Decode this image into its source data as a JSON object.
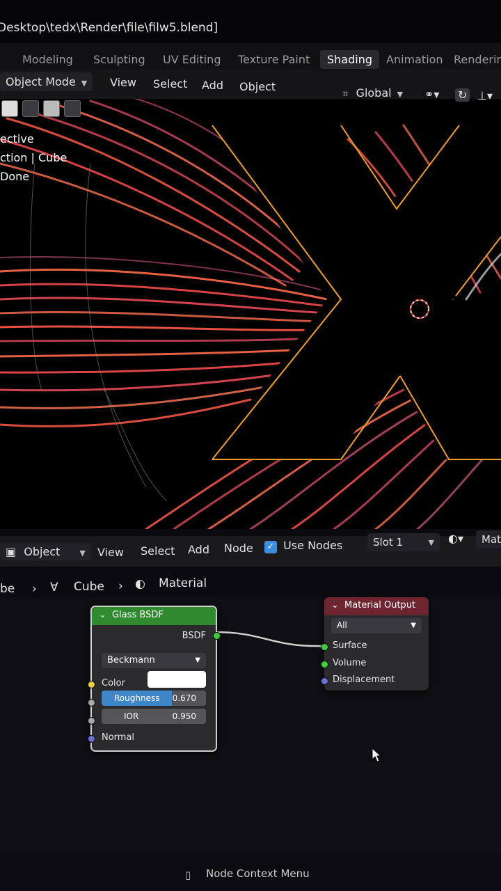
{
  "window": {
    "title": "Desktop\\tedx\\Render\\file\\filw5.blend]"
  },
  "workspace_tabs": [
    {
      "label": "Modeling"
    },
    {
      "label": "Sculpting"
    },
    {
      "label": "UV Editing"
    },
    {
      "label": "Texture Paint"
    },
    {
      "label": "Shading",
      "active": true
    },
    {
      "label": "Animation"
    },
    {
      "label": "Rendering"
    }
  ],
  "viewport_header": {
    "mode": "Object Mode",
    "menus": [
      "View",
      "Select",
      "Add",
      "Object"
    ],
    "transform_orientation": "Global"
  },
  "viewport_overlay": {
    "view_name": "ective",
    "collection": "ction | Cube",
    "status": "Done"
  },
  "node_header": {
    "editor_type": "Object",
    "menus": [
      "View",
      "Select",
      "Add",
      "Node"
    ],
    "use_nodes_label": "Use Nodes",
    "use_nodes_checked": true,
    "slot": "Slot 1",
    "material_partial": "Mate"
  },
  "breadcrumb": {
    "object": "be",
    "mesh": "Cube",
    "material": "Material"
  },
  "glass_node": {
    "title": "Glass BSDF",
    "output_label": "BSDF",
    "distribution": "Beckmann",
    "color_label": "Color",
    "color_value": "#ffffff",
    "roughness_label": "Roughness",
    "roughness_value": "0.670",
    "roughness_fraction": 0.67,
    "ior_label": "IOR",
    "ior_value": "0.950",
    "normal_label": "Normal"
  },
  "output_node": {
    "title": "Material Output",
    "target": "All",
    "inputs": [
      "Surface",
      "Volume",
      "Displacement"
    ]
  },
  "status_bar": {
    "hint": "Node Context Menu"
  },
  "colors": {
    "glass_header": "#2f8a2f",
    "output_header": "#6e2530",
    "roughness_bar": "#3f86c9",
    "outline": "#ffa500"
  }
}
